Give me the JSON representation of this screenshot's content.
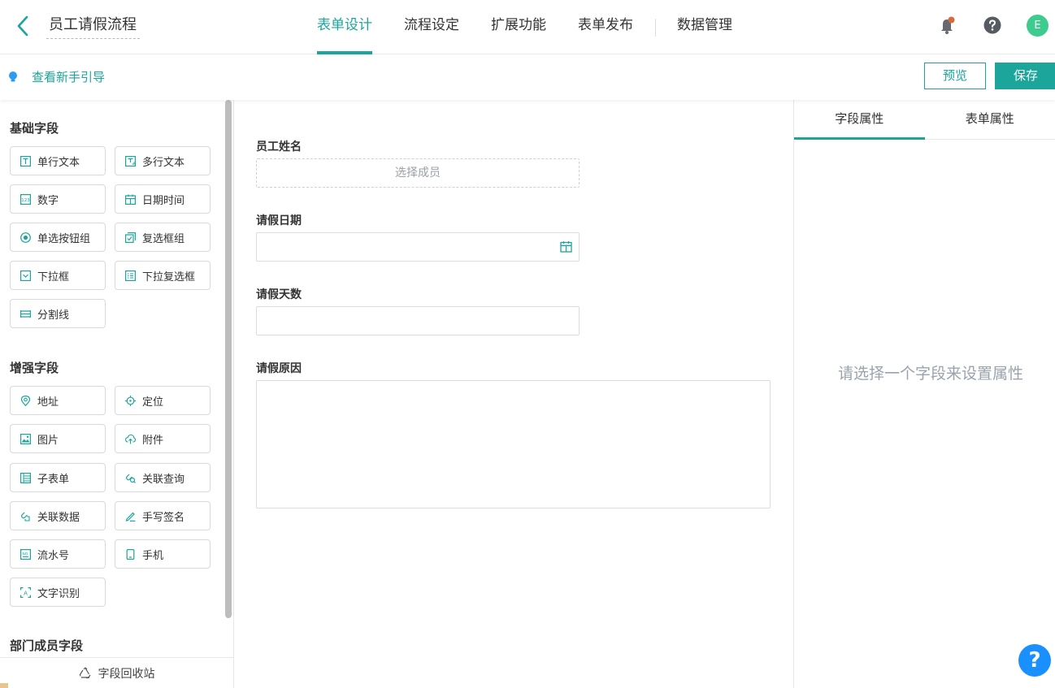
{
  "header": {
    "app_title": "员工请假流程",
    "tabs": [
      {
        "label": "表单设计",
        "active": true
      },
      {
        "label": "流程设定",
        "active": false
      },
      {
        "label": "扩展功能",
        "active": false
      },
      {
        "label": "表单发布",
        "active": false
      },
      {
        "label": "数据管理",
        "active": false
      }
    ],
    "avatar_letter": "E",
    "accent_color": "#1ba59b"
  },
  "subbar": {
    "guide_text": "查看新手引导",
    "preview_label": "预览",
    "save_label": "保存"
  },
  "palette": {
    "basic_title": "基础字段",
    "basic_fields": [
      {
        "label": "单行文本",
        "icon": "text-icon"
      },
      {
        "label": "多行文本",
        "icon": "textarea-icon"
      },
      {
        "label": "数字",
        "icon": "number-icon"
      },
      {
        "label": "日期时间",
        "icon": "calendar-icon"
      },
      {
        "label": "单选按钮组",
        "icon": "radio-icon"
      },
      {
        "label": "复选框组",
        "icon": "checkbox-icon"
      },
      {
        "label": "下拉框",
        "icon": "dropdown-icon"
      },
      {
        "label": "下拉复选框",
        "icon": "multi-dropdown-icon"
      },
      {
        "label": "分割线",
        "icon": "divider-icon"
      }
    ],
    "advanced_title": "增强字段",
    "advanced_fields": [
      {
        "label": "地址",
        "icon": "address-pin-icon"
      },
      {
        "label": "定位",
        "icon": "locate-icon"
      },
      {
        "label": "图片",
        "icon": "image-icon"
      },
      {
        "label": "附件",
        "icon": "upload-cloud-icon"
      },
      {
        "label": "子表单",
        "icon": "subform-icon"
      },
      {
        "label": "关联查询",
        "icon": "link-query-icon"
      },
      {
        "label": "关联数据",
        "icon": "link-data-icon"
      },
      {
        "label": "手写签名",
        "icon": "pen-icon"
      },
      {
        "label": "流水号",
        "icon": "serial-number-icon"
      },
      {
        "label": "手机",
        "icon": "phone-icon"
      },
      {
        "label": "文字识别",
        "icon": "ocr-icon"
      }
    ],
    "dept_title": "部门成员字段",
    "recycle_label": "字段回收站"
  },
  "form": {
    "fields": [
      {
        "label": "员工姓名",
        "placeholder": "选择成员"
      },
      {
        "label": "请假日期"
      },
      {
        "label": "请假天数"
      },
      {
        "label": "请假原因"
      }
    ]
  },
  "props": {
    "tabs": [
      {
        "label": "字段属性",
        "active": true
      },
      {
        "label": "表单属性",
        "active": false
      }
    ],
    "empty_text": "请选择一个字段来设置属性"
  },
  "help_fab": "?"
}
